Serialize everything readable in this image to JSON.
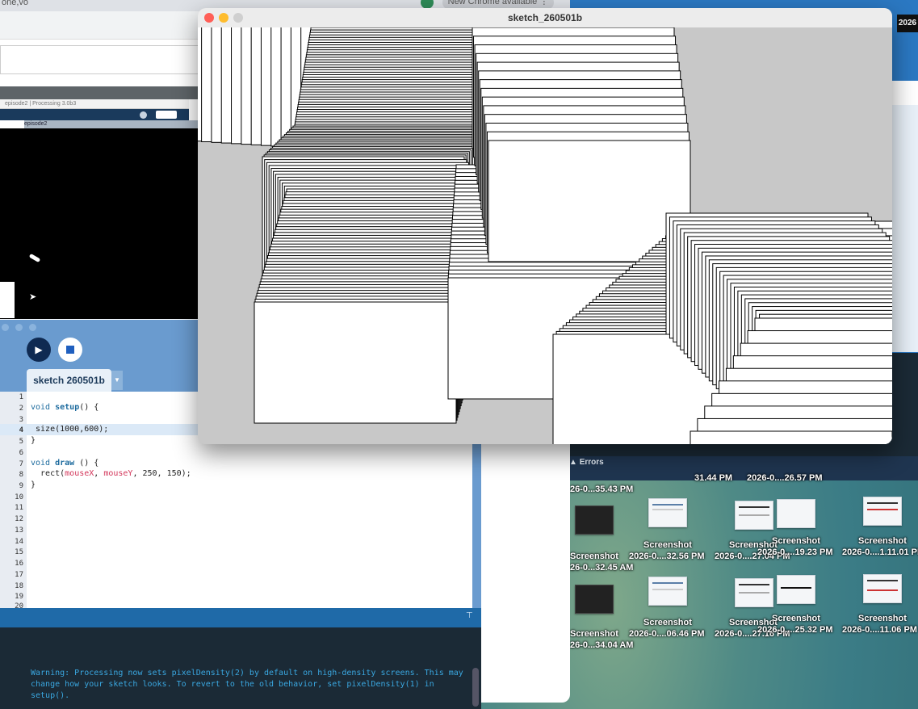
{
  "chrome": {
    "tab_text": "one,vo",
    "update_label": "New Chrome available"
  },
  "nested": {
    "title": "episode2 | Processing 3.0b3",
    "tab": "episode2"
  },
  "ide": {
    "tab_label": "sketch 260501b",
    "tab_arrow": "▼",
    "run_label": "▶",
    "line_numbers": [
      "1",
      "2",
      "3",
      "4",
      "5",
      "6",
      "7",
      "8",
      "9",
      "10",
      "11",
      "12",
      "13",
      "14",
      "15",
      "16",
      "17",
      "18",
      "19",
      "20"
    ],
    "code": {
      "setup_kw": "void",
      "setup_fn": "setup",
      "setup_rest": "() {",
      "size_call": " size(1000,600);",
      "close1": "}",
      "draw_kw": "void",
      "draw_fn": "draw",
      "draw_rest": " () {",
      "rect_pre": "  rect(",
      "mouse_x": "mouseX",
      "sep": ", ",
      "mouse_y": "mouseY",
      "rect_post": ", 250, 150);",
      "close2": "}"
    },
    "console_message": "Warning: Processing now sets pixelDensity(2) by default on high-density screens. This may change how your sketch looks. To revert to the old behavior, set pixelDensity(1) in setup().",
    "errors_label": "Errors"
  },
  "sketch": {
    "title": "sketch_260501b"
  },
  "desktop": {
    "corner_label": "2026",
    "files": [
      {
        "name": "Screenshot",
        "date": "2026-0....32.56 PM"
      },
      {
        "name": "Screenshot",
        "date": "2026-0....27.04 PM"
      },
      {
        "name": "Screenshot",
        "date": "2026-0....19.23 PM"
      },
      {
        "name": "Screenshot",
        "date": "2026-0....1.11.01 PM"
      },
      {
        "name": "Screenshot",
        "date": "26-0...32.45 AM"
      },
      {
        "name": "Screenshot",
        "date": "2026-0....06.46 PM"
      },
      {
        "name": "Screenshot",
        "date": "2026-0....27.16 PM"
      },
      {
        "name": "Screenshot",
        "date": "2026-0....25.32 PM"
      },
      {
        "name": "Screenshot",
        "date": "2026-0....11.06 PM"
      },
      {
        "name": "Screenshot",
        "date": "26-0...34.04 AM"
      }
    ],
    "top_labels": [
      "26-0...35.43 PM",
      "31.44 PM",
      "2026-0....26.57 PM"
    ]
  },
  "colors": {
    "ide_blue": "#6a9bcf",
    "console_bg": "#1b2a36",
    "console_text": "#3aa7e0",
    "close_dot": "#ff5f57",
    "min_dot": "#febc2e",
    "max_dot": "#cfcfcf"
  }
}
